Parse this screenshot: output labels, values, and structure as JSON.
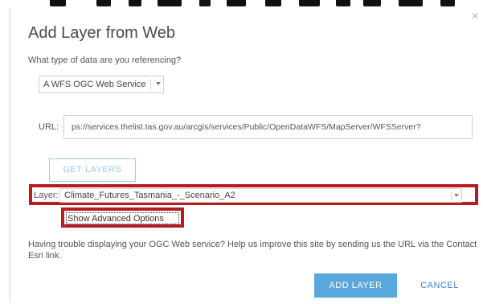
{
  "dialog": {
    "title": "Add Layer from Web",
    "close_label": "×",
    "question": "What type of data are you referencing?",
    "data_type": {
      "selected": "A WFS OGC Web Service"
    },
    "url": {
      "label": "URL:",
      "value": "ps://services.thelist.tas.gov.au/arcgis/services/Public/OpenDataWFS/MapServer/WFSServer?"
    },
    "get_layers_label": "GET LAYERS",
    "layer": {
      "label": "Layer:",
      "selected": "Climate_Futures_Tasmania_-_Scenario_A2"
    },
    "advanced_options_label": "Show Advanced Options",
    "help_text": "Having trouble displaying your OGC Web service? Help us improve this site by sending us the URL via the Contact Esri link.",
    "add_layer_label": "ADD LAYER",
    "cancel_label": "CANCEL"
  },
  "colors": {
    "highlight_border": "#b81c22",
    "primary_button": "#5aa7db",
    "link": "#3c87c4",
    "disabled_button_text": "#9ec7e6"
  }
}
